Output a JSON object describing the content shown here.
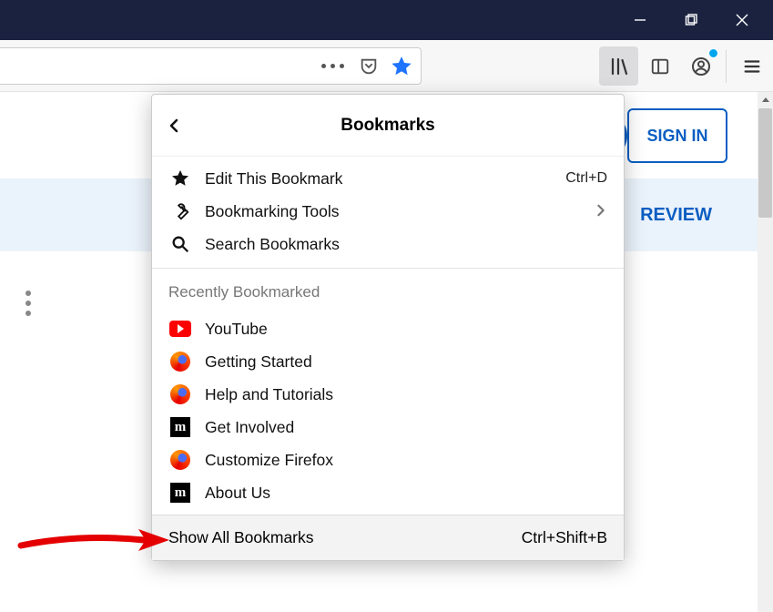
{
  "panel": {
    "title": "Bookmarks",
    "items": [
      {
        "label": "Edit This Bookmark",
        "accel": "Ctrl+D",
        "icon": "star-icon"
      },
      {
        "label": "Bookmarking Tools",
        "submenu": true,
        "icon": "wrench-icon"
      },
      {
        "label": "Search Bookmarks",
        "icon": "search-icon"
      }
    ],
    "recent_label": "Recently Bookmarked",
    "recent": [
      {
        "label": "YouTube",
        "icon": "youtube"
      },
      {
        "label": "Getting Started",
        "icon": "firefox"
      },
      {
        "label": "Help and Tutorials",
        "icon": "firefox"
      },
      {
        "label": "Get Involved",
        "icon": "mozilla"
      },
      {
        "label": "Customize Firefox",
        "icon": "firefox"
      },
      {
        "label": "About Us",
        "icon": "mozilla"
      }
    ],
    "footer": {
      "label": "Show All Bookmarks",
      "accel": "Ctrl+Shift+B"
    }
  },
  "page": {
    "signin": "SIGN IN",
    "review": "REVIEW"
  }
}
